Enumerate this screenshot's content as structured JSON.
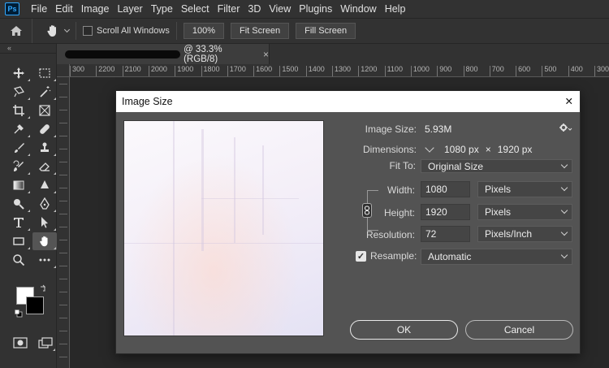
{
  "app": {
    "logo": "Ps"
  },
  "menu": [
    "File",
    "Edit",
    "Image",
    "Layer",
    "Type",
    "Select",
    "Filter",
    "3D",
    "View",
    "Plugins",
    "Window",
    "Help"
  ],
  "options_bar": {
    "scroll_all_windows": "Scroll All Windows",
    "zoom_100": "100%",
    "fit_screen": "Fit Screen",
    "fill_screen": "Fill Screen"
  },
  "toolbar": {
    "collapse_glyph": "«"
  },
  "document": {
    "title_suffix": "@ 33.3% (RGB/8)",
    "close": "×"
  },
  "ruler_ticks": [
    "300",
    "2200",
    "2100",
    "2000",
    "1900",
    "1800",
    "1700",
    "1600",
    "1500",
    "1400",
    "1300",
    "1200",
    "1100",
    "1000",
    "900",
    "800",
    "700",
    "600",
    "500",
    "400",
    "300"
  ],
  "dialog": {
    "title": "Image Size",
    "close": "✕",
    "image_size_label": "Image Size:",
    "image_size_value": "5.93M",
    "dimensions_label": "Dimensions:",
    "dimensions_width": "1080 px",
    "dimensions_times": "×",
    "dimensions_height": "1920 px",
    "fit_to_label": "Fit To:",
    "fit_to_value": "Original Size",
    "width_label": "Width:",
    "width_value": "1080",
    "width_unit": "Pixels",
    "height_label": "Height:",
    "height_value": "1920",
    "height_unit": "Pixels",
    "resolution_label": "Resolution:",
    "resolution_value": "72",
    "resolution_unit": "Pixels/Inch",
    "resample_label": "Resample:",
    "resample_value": "Automatic",
    "ok": "OK",
    "cancel": "Cancel"
  },
  "colors": {
    "foreground": "#ffffff",
    "background": "#000000",
    "panel": "#535353",
    "ui": "#323232"
  }
}
